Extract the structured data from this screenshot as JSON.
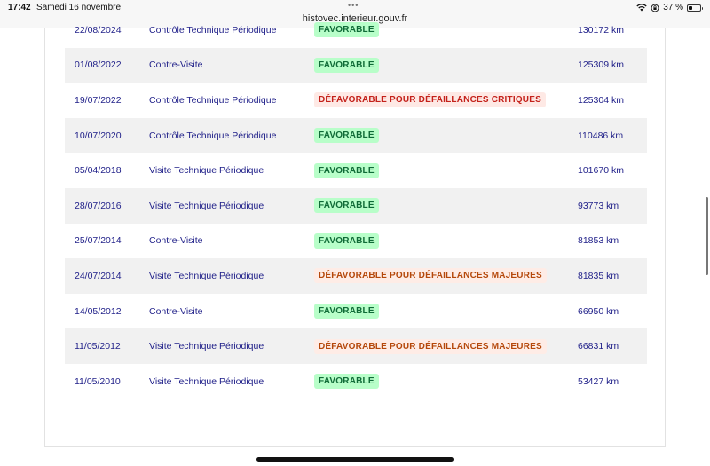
{
  "status_bar": {
    "time": "17:42",
    "date": "Samedi 16 novembre",
    "url": "histovec.interieur.gouv.fr",
    "battery": "37 %",
    "battery_level": 0.37
  },
  "colors": {
    "link_text": "#22228a",
    "favorable_bg": "#b8fec9",
    "favorable_text": "#0f6b37",
    "critical_bg": "#fee9e5",
    "critical_text": "#c4211a",
    "major_bg": "#feece6",
    "major_text": "#b5480b"
  },
  "inspections": [
    {
      "date": "22/08/2024",
      "type": "Contrôle Technique Périodique",
      "result": "FAVORABLE",
      "status": "ok",
      "km": "130172 km"
    },
    {
      "date": "01/08/2022",
      "type": "Contre-Visite",
      "result": "FAVORABLE",
      "status": "ok",
      "km": "125309 km"
    },
    {
      "date": "19/07/2022",
      "type": "Contrôle Technique Périodique",
      "result": "DÉFAVORABLE POUR DÉFAILLANCES CRITIQUES",
      "status": "ko",
      "km": "125304 km"
    },
    {
      "date": "10/07/2020",
      "type": "Contrôle Technique Périodique",
      "result": "FAVORABLE",
      "status": "ok",
      "km": "110486 km"
    },
    {
      "date": "05/04/2018",
      "type": "Visite Technique Périodique",
      "result": "FAVORABLE",
      "status": "ok",
      "km": "101670 km"
    },
    {
      "date": "28/07/2016",
      "type": "Visite Technique Périodique",
      "result": "FAVORABLE",
      "status": "ok",
      "km": "93773 km"
    },
    {
      "date": "25/07/2014",
      "type": "Contre-Visite",
      "result": "FAVORABLE",
      "status": "ok",
      "km": "81853 km"
    },
    {
      "date": "24/07/2014",
      "type": "Visite Technique Périodique",
      "result": "DÉFAVORABLE POUR DÉFAILLANCES MAJEURES",
      "status": "major",
      "km": "81835 km"
    },
    {
      "date": "14/05/2012",
      "type": "Contre-Visite",
      "result": "FAVORABLE",
      "status": "ok",
      "km": "66950 km"
    },
    {
      "date": "11/05/2012",
      "type": "Visite Technique Périodique",
      "result": "DÉFAVORABLE POUR DÉFAILLANCES MAJEURES",
      "status": "major",
      "km": "66831 km"
    },
    {
      "date": "11/05/2010",
      "type": "Visite Technique Périodique",
      "result": "FAVORABLE",
      "status": "ok",
      "km": "53427 km"
    }
  ]
}
